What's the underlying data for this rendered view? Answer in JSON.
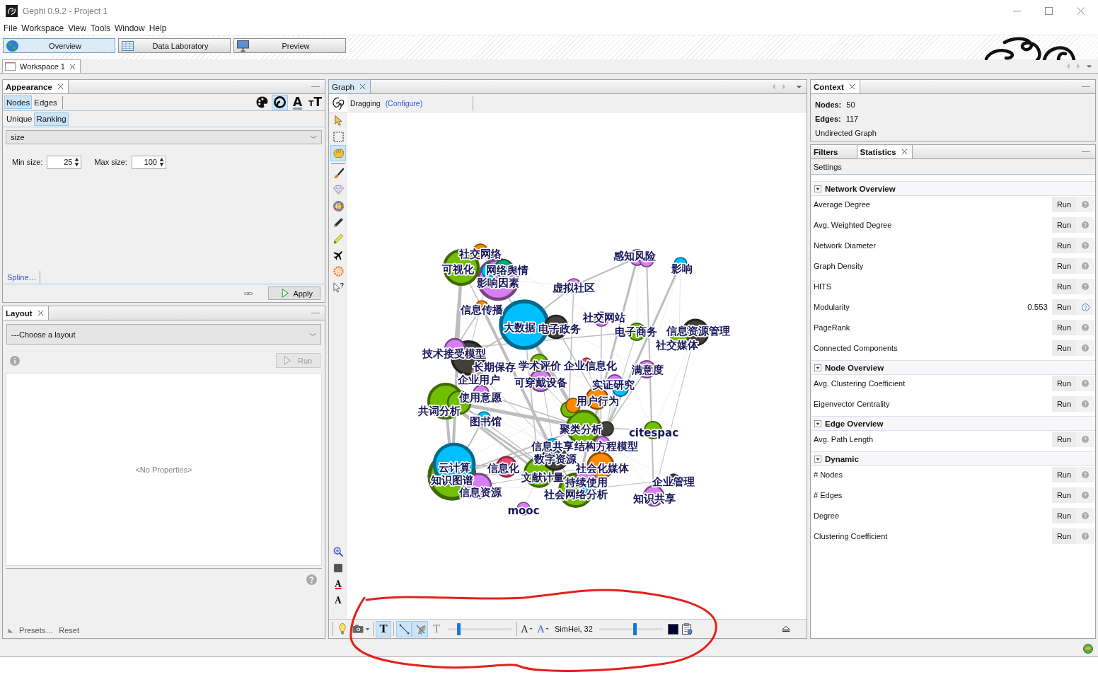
{
  "window": {
    "title": "Gephi 0.9.2 - Project 1"
  },
  "menu": [
    "File",
    "Workspace",
    "View",
    "Tools",
    "Window",
    "Help"
  ],
  "perspectives": [
    {
      "kind": "overview",
      "label": "Overview",
      "selected": true
    },
    {
      "kind": "data",
      "label": "Data Laboratory",
      "selected": false
    },
    {
      "kind": "preview",
      "label": "Preview",
      "selected": false
    }
  ],
  "workspace_tabs": [
    {
      "label": "Workspace 1",
      "selected": true
    }
  ],
  "appearance": {
    "title": "Appearance",
    "element_tabs": [
      {
        "label": "Nodes",
        "selected": true
      },
      {
        "label": "Edges",
        "selected": false
      }
    ],
    "property_tools": [
      {
        "kind": "color",
        "selected": false
      },
      {
        "kind": "size",
        "selected": true
      },
      {
        "kind": "label-color",
        "glyph": "A",
        "selected": false
      },
      {
        "kind": "label-size",
        "glyph": "TT",
        "selected": false
      }
    ],
    "mode_tabs": [
      {
        "label": "Unique",
        "selected": false
      },
      {
        "label": "Ranking",
        "selected": true
      }
    ],
    "attribute": "size",
    "min_label": "Min size:",
    "min_value": "25",
    "max_label": "Max size:",
    "max_value": "100",
    "spline_link": "Spline…",
    "apply_button": "Apply"
  },
  "layout": {
    "title": "Layout",
    "selection": "---Choose a layout",
    "run_button": "Run",
    "run_disabled": true,
    "properties_empty": "<No Properties>",
    "presets": "Presets…",
    "reset": "Reset"
  },
  "graph": {
    "title": "Graph",
    "tool_name": "Dragging",
    "configure_link": "(Configure)",
    "select_tools": [
      {
        "kind": "pointer",
        "selected": false
      },
      {
        "kind": "rectangle",
        "selected": false
      },
      {
        "kind": "drag",
        "selected": true
      }
    ],
    "action_tools": [
      {
        "kind": "brush"
      },
      {
        "kind": "diamond"
      },
      {
        "kind": "painter"
      },
      {
        "kind": "pencil"
      },
      {
        "kind": "highlighter"
      },
      {
        "kind": "airplane"
      },
      {
        "kind": "ring"
      },
      {
        "kind": "pointer-help"
      }
    ],
    "view_tools": [
      {
        "kind": "zoom"
      },
      {
        "kind": "background"
      },
      {
        "kind": "label-color",
        "glyph": "A"
      },
      {
        "kind": "label-font",
        "glyph": "A"
      }
    ],
    "nodes": [
      {
        "label": "社交网络",
        "color": "#ff8a00"
      },
      {
        "label": "感知风险",
        "color": "#d77ff2"
      },
      {
        "color": "#d77ff2"
      },
      {
        "label": "可视化",
        "color": "#72bf00"
      },
      {
        "label": "网络舆情",
        "color": "#00a67e"
      },
      {
        "color": "#00bfff"
      },
      {
        "label": "影响",
        "color": "#00bfff"
      },
      {
        "label": "影响因素",
        "color": "#d77ff2"
      },
      {
        "label": "虚拟社区",
        "color": "#d77ff2"
      },
      {
        "label": "信息传播",
        "color": "#ff8a00"
      },
      {
        "label": "社交网站",
        "color": "#d77ff2"
      },
      {
        "label": "大数据",
        "color": "#00bfff"
      },
      {
        "label": "电子政务",
        "color": "#433f3b"
      },
      {
        "label": "电子商务",
        "color": "#72bf00"
      },
      {
        "label": "信息资源管理",
        "color": "#433f3b"
      },
      {
        "label": "社交媒体",
        "color": "#72bf00"
      },
      {
        "label": "技术接受模型",
        "color": "#d77ff2"
      },
      {
        "label": "长期保存",
        "color": "#433f3b"
      },
      {
        "label": "学术评价",
        "color": "#72bf00"
      },
      {
        "label": "企业信息化",
        "color": "#f4456b"
      },
      {
        "label": "满意度",
        "color": "#d77ff2"
      },
      {
        "label": "企业用户",
        "color": "#c8a8a2"
      },
      {
        "label": "可穿戴设备",
        "color": "#d77ff2"
      },
      {
        "label": "实证研究",
        "color": "#d77ff2"
      },
      {
        "color": "#00bfff"
      },
      {
        "label": "使用意愿",
        "color": "#d77ff2"
      },
      {
        "label": "用户行为",
        "color": "#ff8a00"
      },
      {
        "color": "#72bf00"
      },
      {
        "label": "共词分析",
        "color": "#72bf00"
      },
      {
        "color": "#ff8a00"
      },
      {
        "color": "#72bf00"
      },
      {
        "label": "图书馆",
        "color": "#00bfff"
      },
      {
        "color": "#433f3b"
      },
      {
        "label": "聚类分析",
        "color": "#72bf00"
      },
      {
        "label": "citespac",
        "color": "#72bf00"
      },
      {
        "label": "信息共享",
        "color": "#00bfff"
      },
      {
        "label": "结构方程模型",
        "color": "#d77ff2"
      },
      {
        "label": "数字资源",
        "color": "#433f3b"
      },
      {
        "label": "云计算",
        "color": "#00bfff"
      },
      {
        "label": "信息化",
        "color": "#f4456b"
      },
      {
        "label": "社会化媒体",
        "color": "#ff8a00"
      },
      {
        "label": "知识图谱",
        "color": "#72bf00"
      },
      {
        "label": "文献计量",
        "color": "#72bf00"
      },
      {
        "label": "持续使用",
        "color": "#d77ff2"
      },
      {
        "label": "企业管理",
        "color": "#433f3b"
      },
      {
        "color": "#00bfff"
      },
      {
        "label": "信息资源",
        "color": "#d77ff2"
      },
      {
        "label": "社会网络分析",
        "color": "#72bf00"
      },
      {
        "label": "知识共享",
        "color": "#d77ff2"
      },
      {
        "label": "mooc",
        "color": "#d77ff2"
      }
    ],
    "bottom_bar": {
      "buttons": [
        {
          "kind": "light"
        },
        {
          "kind": "screenshot"
        }
      ],
      "toggles": [
        {
          "kind": "show-labels",
          "glyph": "T",
          "on": true,
          "disabled": false
        },
        {
          "kind": "show-edges",
          "on": true,
          "disabled": false
        },
        {
          "kind": "edge-color",
          "on": true,
          "disabled": false
        },
        {
          "kind": "label-size",
          "glyph": "T",
          "on": false,
          "disabled": true
        }
      ],
      "edge_scale": {
        "level": 0.15
      },
      "font_modes": [
        {
          "kind": "size-mode",
          "glyph": "A"
        },
        {
          "kind": "color-mode",
          "glyph": "A"
        }
      ],
      "font": "SimHei, 32",
      "label_scale": {
        "level": 0.57
      }
    }
  },
  "context": {
    "title": "Context",
    "rows": [
      {
        "label": "Nodes:",
        "value": "50"
      },
      {
        "label": "Edges:",
        "value": "117"
      }
    ],
    "graph_type": "Undirected Graph"
  },
  "side_tabs": [
    {
      "label": "Filters",
      "selected": false
    },
    {
      "label": "Statistics",
      "selected": true
    }
  ],
  "statistics": {
    "settings": "Settings",
    "sections": [
      {
        "title": "Network Overview",
        "expanded": true,
        "rows": [
          {
            "name": "Average Degree",
            "run": "Run",
            "computed": false
          },
          {
            "name": "Avg. Weighted Degree",
            "run": "Run",
            "computed": false
          },
          {
            "name": "Network Diameter",
            "run": "Run",
            "computed": false
          },
          {
            "name": "Graph Density",
            "run": "Run",
            "computed": false
          },
          {
            "name": "HITS",
            "run": "Run",
            "computed": false
          },
          {
            "name": "Modularity",
            "value": "0.553",
            "run": "Run",
            "computed": true
          },
          {
            "name": "PageRank",
            "run": "Run",
            "computed": false
          },
          {
            "name": "Connected Components",
            "run": "Run",
            "computed": false
          }
        ]
      },
      {
        "title": "Node Overview",
        "expanded": true,
        "rows": [
          {
            "name": "Avg. Clustering Coefficient",
            "run": "Run",
            "computed": false
          },
          {
            "name": "Eigenvector Centrality",
            "run": "Run",
            "computed": false
          }
        ]
      },
      {
        "title": "Edge Overview",
        "expanded": true,
        "rows": [
          {
            "name": "Avg. Path Length",
            "run": "Run",
            "computed": false
          }
        ]
      },
      {
        "title": "Dynamic",
        "expanded": true,
        "rows": [
          {
            "name": "# Nodes",
            "run": "Run",
            "computed": false
          },
          {
            "name": "# Edges",
            "run": "Run",
            "computed": false
          },
          {
            "name": "Degree",
            "run": "Run",
            "computed": false
          },
          {
            "name": "Clustering Coefficient",
            "run": "Run",
            "computed": false
          }
        ]
      }
    ]
  }
}
